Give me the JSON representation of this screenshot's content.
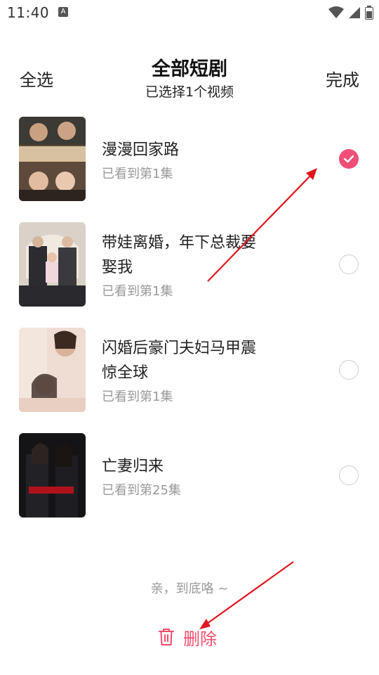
{
  "status_bar": {
    "time": "11:40",
    "notification_icon": "A"
  },
  "header": {
    "select_all": "全选",
    "title": "全部短剧",
    "subtitle": "已选择1个视频",
    "done": "完成"
  },
  "items": [
    {
      "title": "漫漫回家路",
      "progress": "已看到第1集",
      "checked": true
    },
    {
      "title": "带娃离婚，年下总裁要娶我",
      "progress": "已看到第1集",
      "checked": false
    },
    {
      "title": "闪婚后豪门夫妇马甲震惊全球",
      "progress": "已看到第1集",
      "checked": false
    },
    {
      "title": "亡妻归来",
      "progress": "已看到第25集",
      "checked": false
    }
  ],
  "footer": {
    "end_text": "亲，到底咯 ~",
    "delete_label": "删除"
  },
  "colors": {
    "accent": "#f14f78",
    "delete": "#ef4d6b",
    "annotation_arrow": "#e0141e"
  },
  "icons": [
    "wifi-icon",
    "signal-icon",
    "battery-icon",
    "check-icon",
    "trash-icon"
  ]
}
